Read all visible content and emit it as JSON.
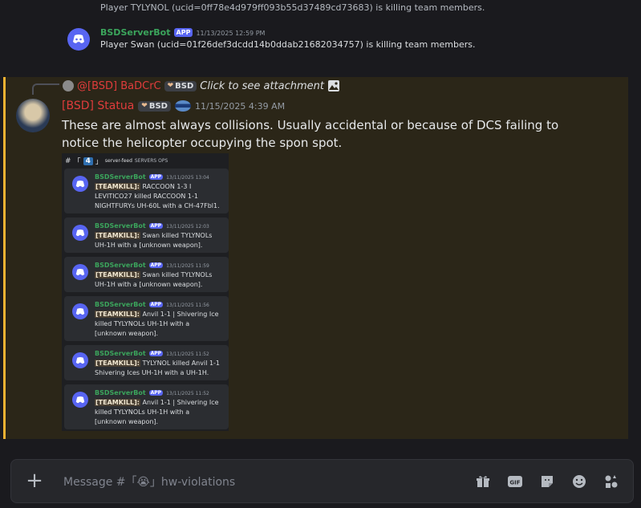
{
  "earlier": {
    "line1": "Player TYLYNOL (ucid=0ff78e4d979ff093b55d37489cd73683) is killing team members.",
    "bot_name": "BSDServerBot",
    "app_label": "APP",
    "timestamp": "11/13/2025 12:59 PM",
    "text": "Player Swan (ucid=01f26def3dcdd14b0ddab21682034757) is killing team members."
  },
  "reply": {
    "user": "@[BSD] BaDCrC",
    "tag": "BSD",
    "text": "Click to see attachment"
  },
  "message": {
    "user": "[BSD] Statua",
    "tag": "BSD",
    "timestamp": "11/15/2025 4:39 AM",
    "text": "These are almost always collisions. Usually accidental or because of DCS failing to notice the helicopter occupying the spon spot."
  },
  "attachment": {
    "channel_num": "4",
    "channel": "server-feed",
    "category": "SERVERS OPS",
    "cards": [
      {
        "bot": "BSDServerBot",
        "app": "APP",
        "ts": "13/11/2025 13:04",
        "tag": "[TEAMKILL]:",
        "text": " RACCOON 1-3 I LEVITICO27 killed RACCOON 1-1  NIGHTFURYs UH-60L with a CH-47Fbl1."
      },
      {
        "bot": "BSDServerBot",
        "app": "APP",
        "ts": "13/11/2025 12:03",
        "tag": "[TEAMKILL]:",
        "text": " Swan killed TYLYNOLs UH-1H with a [unknown weapon]."
      },
      {
        "bot": "BSDServerBot",
        "app": "APP",
        "ts": "13/11/2025 11:59",
        "tag": "[TEAMKILL]:",
        "text": " Swan killed TYLYNOLs UH-1H with a [unknown weapon]."
      },
      {
        "bot": "BSDServerBot",
        "app": "APP",
        "ts": "13/11/2025 11:56",
        "tag": "[TEAMKILL]:",
        "text": " Anvil 1-1 | Shivering Ice killed TYLYNOLs UH-1H with a [unknown weapon]."
      },
      {
        "bot": "BSDServerBot",
        "app": "APP",
        "ts": "13/11/2025 11:52",
        "tag": "[TEAMKILL]:",
        "text": " TYLYNOL killed Anvil 1-1 Shivering Ices UH-1H with a UH-1H."
      },
      {
        "bot": "BSDServerBot",
        "app": "APP",
        "ts": "13/11/2025 11:52",
        "tag": "[TEAMKILL]:",
        "text": " Anvil 1-1 | Shivering Ice killed TYLYNOLs UH-1H with a [unknown weapon]."
      }
    ]
  },
  "composer": {
    "placeholder": "Message #「😭」hw-violations",
    "icons": [
      "gift-icon",
      "gif-icon",
      "sticker-icon",
      "emoji-icon",
      "apps-icon"
    ]
  },
  "colors": {
    "accent": "#5865f2",
    "bot_name": "#3ba55c",
    "user_name": "#e03c3c",
    "highlight_bar": "#f0b232"
  }
}
